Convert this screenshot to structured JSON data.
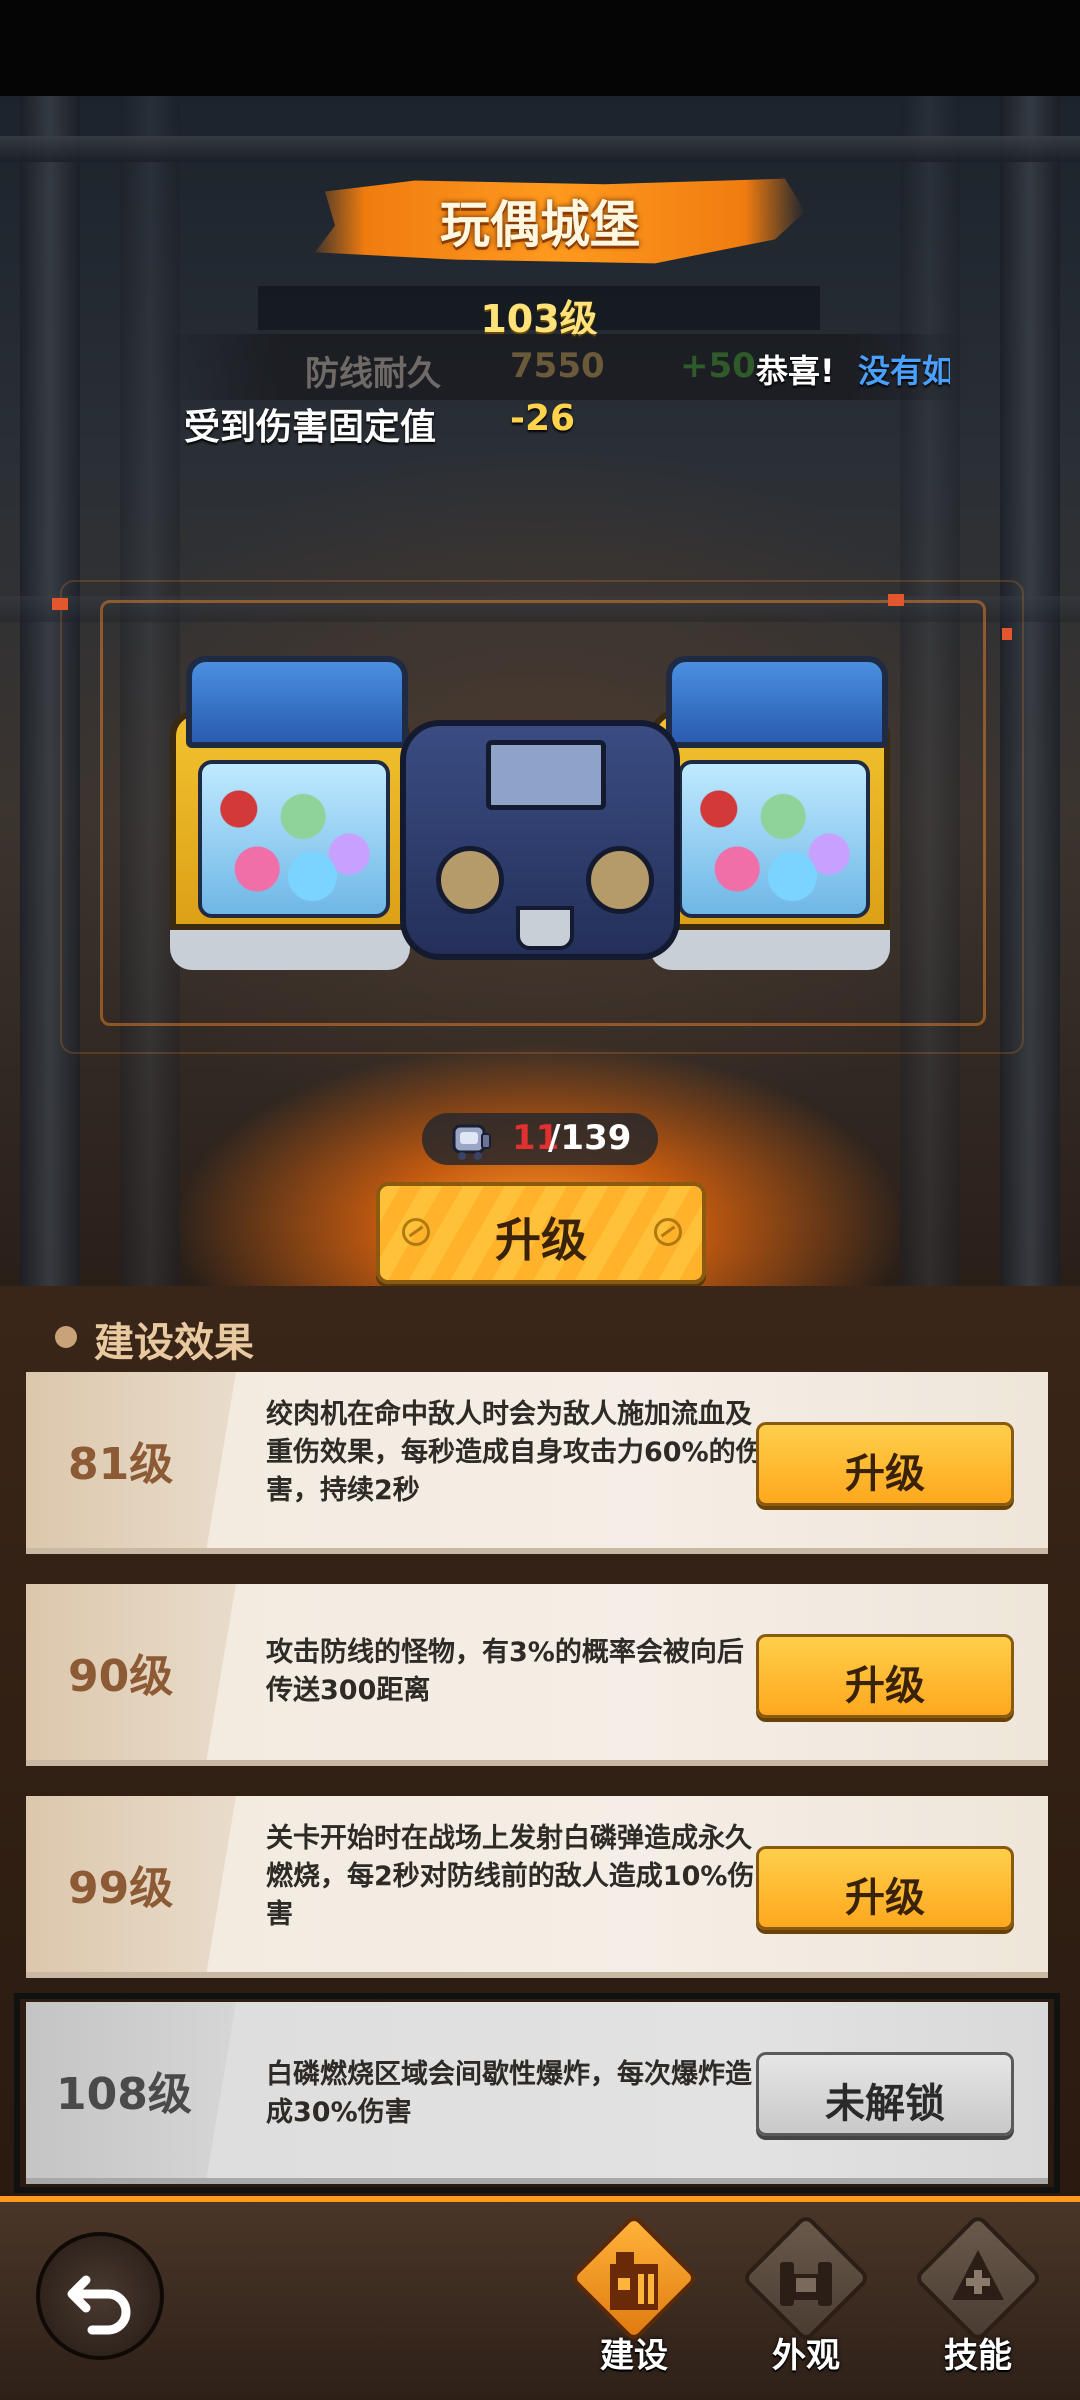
{
  "title": "玩偶城堡",
  "level": "103级",
  "stats": {
    "defense_label": "防线耐久",
    "defense_value": "7550",
    "defense_bonus": "+50",
    "damage_label": "受到伤害固定值",
    "damage_value": "-26"
  },
  "notification": {
    "congrats": "恭喜!",
    "message": "没有如"
  },
  "materials": {
    "icon": "doll-box-icon",
    "current": "11",
    "total": "/139"
  },
  "upgrade_button": "升级",
  "section_title": "建设效果",
  "effects": [
    {
      "level": "81级",
      "description": "绞肉机在命中敌人时会为敌人施加流血及重伤效果，每秒造成自身攻击力60%的伤害，持续2秒",
      "button": "升级",
      "locked": false
    },
    {
      "level": "90级",
      "description": "攻击防线的怪物，有3%的概率会被向后传送300距离",
      "button": "升级",
      "locked": false
    },
    {
      "level": "99级",
      "description": "关卡开始时在战场上发射白磷弹造成永久燃烧，每2秒对防线前的敌人造成10%伤害",
      "button": "升级",
      "locked": false
    },
    {
      "level": "108级",
      "description": "白磷燃烧区域会间歇性爆炸，每次爆炸造成30%伤害",
      "button": "未解锁",
      "locked": true
    }
  ],
  "bottom_nav": {
    "back_icon": "back-arrow-icon",
    "items": [
      {
        "label": "建设",
        "icon": "building-icon",
        "active": true
      },
      {
        "label": "外观",
        "icon": "appearance-icon",
        "active": false
      },
      {
        "label": "技能",
        "icon": "skill-icon",
        "active": false
      }
    ]
  },
  "colors": {
    "accent_orange": "#ff9a1e",
    "button_yellow": "#ffb22a",
    "level_gold": "#ffe27a",
    "notify_blue": "#4aa0ff",
    "count_red": "#e03030"
  }
}
